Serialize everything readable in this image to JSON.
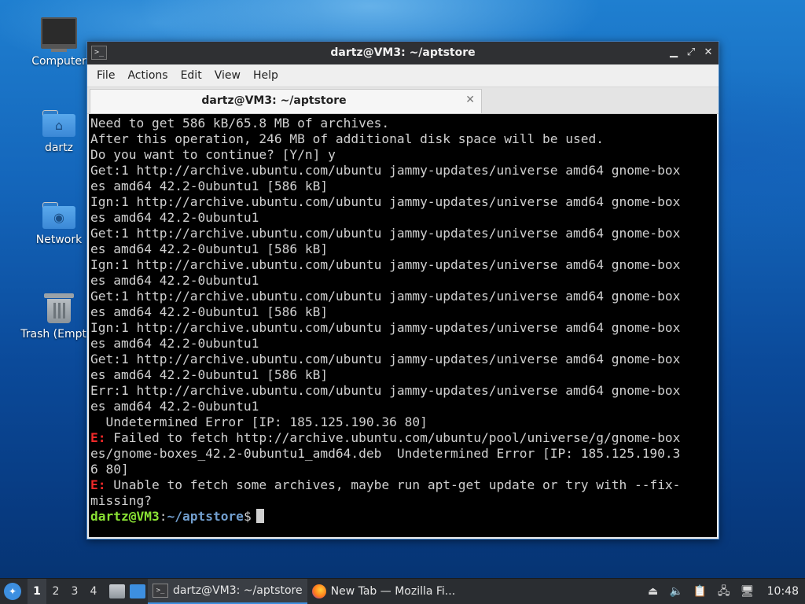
{
  "desktop": {
    "icons": [
      {
        "label": "Computer",
        "icon": "computer-icon"
      },
      {
        "label": "dartz",
        "icon": "home-folder-icon"
      },
      {
        "label": "Network",
        "icon": "network-folder-icon"
      },
      {
        "label": "Trash (Empty)",
        "icon": "trash-icon"
      }
    ]
  },
  "window": {
    "title": "dartz@VM3: ~/aptstore",
    "controls": {
      "minimize": "▁",
      "maximize": "⤢",
      "close": "✕"
    },
    "menu": [
      "File",
      "Actions",
      "Edit",
      "View",
      "Help"
    ],
    "tab": {
      "title": "dartz@VM3: ~/aptstore",
      "close": "✕"
    }
  },
  "terminal": {
    "lines": [
      "Need to get 586 kB/65.8 MB of archives.",
      "After this operation, 246 MB of additional disk space will be used.",
      "Do you want to continue? [Y/n] y",
      "Get:1 http://archive.ubuntu.com/ubuntu jammy-updates/universe amd64 gnome-box",
      "es amd64 42.2-0ubuntu1 [586 kB]",
      "Ign:1 http://archive.ubuntu.com/ubuntu jammy-updates/universe amd64 gnome-box",
      "es amd64 42.2-0ubuntu1",
      "Get:1 http://archive.ubuntu.com/ubuntu jammy-updates/universe amd64 gnome-box",
      "es amd64 42.2-0ubuntu1 [586 kB]",
      "Ign:1 http://archive.ubuntu.com/ubuntu jammy-updates/universe amd64 gnome-box",
      "es amd64 42.2-0ubuntu1",
      "Get:1 http://archive.ubuntu.com/ubuntu jammy-updates/universe amd64 gnome-box",
      "es amd64 42.2-0ubuntu1 [586 kB]",
      "Ign:1 http://archive.ubuntu.com/ubuntu jammy-updates/universe amd64 gnome-box",
      "es amd64 42.2-0ubuntu1",
      "Get:1 http://archive.ubuntu.com/ubuntu jammy-updates/universe amd64 gnome-box",
      "es amd64 42.2-0ubuntu1 [586 kB]",
      "Err:1 http://archive.ubuntu.com/ubuntu jammy-updates/universe amd64 gnome-box",
      "es amd64 42.2-0ubuntu1",
      "  Undetermined Error [IP: 185.125.190.36 80]"
    ],
    "error1": {
      "tag": "E:",
      "lines": [
        " Failed to fetch http://archive.ubuntu.com/ubuntu/pool/universe/g/gnome-box",
        "es/gnome-boxes_42.2-0ubuntu1_amd64.deb  Undetermined Error [IP: 185.125.190.3",
        "6 80]"
      ]
    },
    "error2": {
      "tag": "E:",
      "lines": [
        " Unable to fetch some archives, maybe run apt-get update or try with --fix-",
        "missing?"
      ]
    },
    "prompt": {
      "user_host": "dartz@VM3",
      "sep": ":",
      "path": "~/aptstore",
      "symbol": "$"
    },
    "colors": {
      "error": "#ef2929",
      "user": "#8ae234",
      "path": "#729fcf"
    }
  },
  "taskbar": {
    "workspaces": [
      "1",
      "2",
      "3",
      "4"
    ],
    "active_workspace": "1",
    "tasks": [
      {
        "label": "dartz@VM3: ~/aptstore",
        "icon": "terminal-icon",
        "active": true
      },
      {
        "label": "New Tab — Mozilla Fi...",
        "icon": "firefox-icon",
        "active": false
      }
    ],
    "clock": "10:48"
  }
}
